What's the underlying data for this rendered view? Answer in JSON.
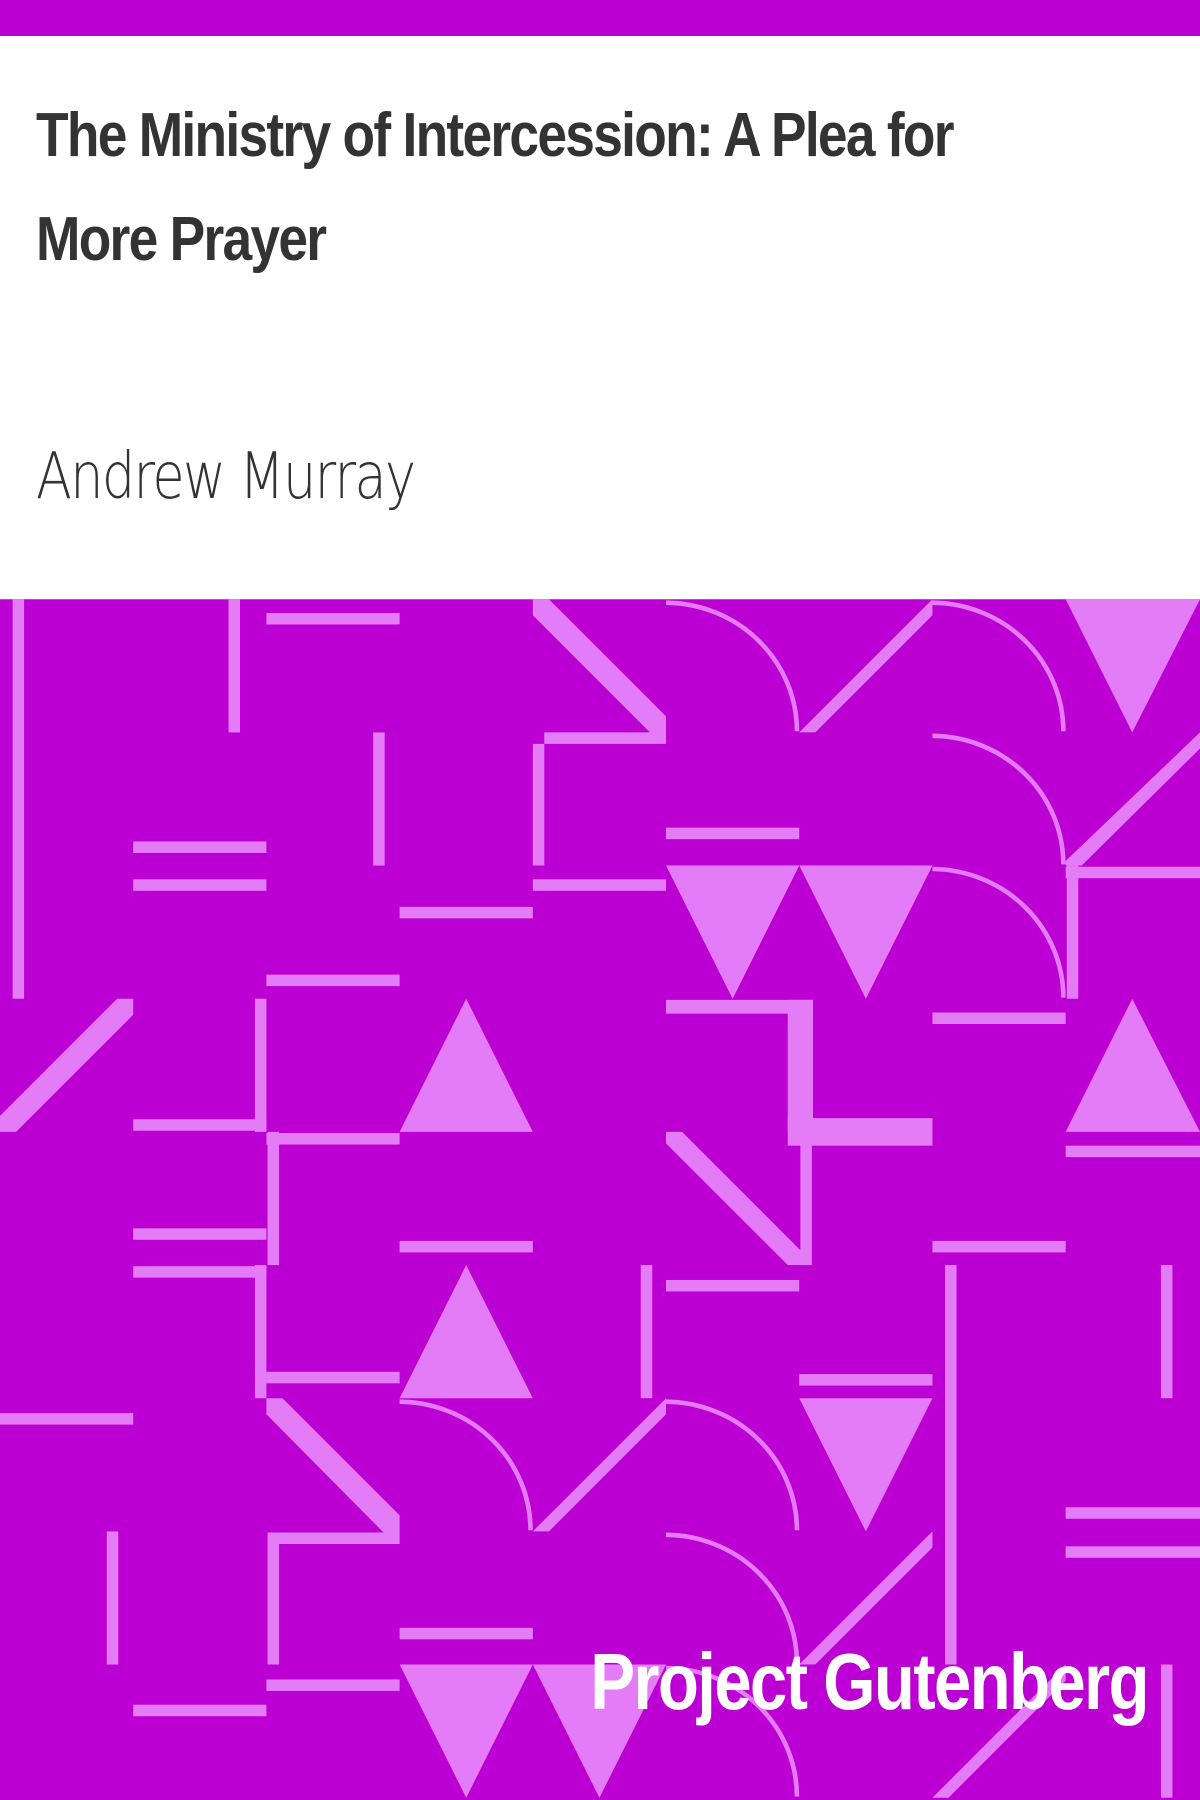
{
  "book": {
    "title": "The Ministry of Intercession: A Plea for More Prayer",
    "author": "Andrew Murray",
    "publisher": "Project Gutenberg"
  },
  "colors": {
    "background": "#bc00d4",
    "pattern": "#e57cf7",
    "text": "#333333",
    "brand_text": "#ffffff"
  }
}
